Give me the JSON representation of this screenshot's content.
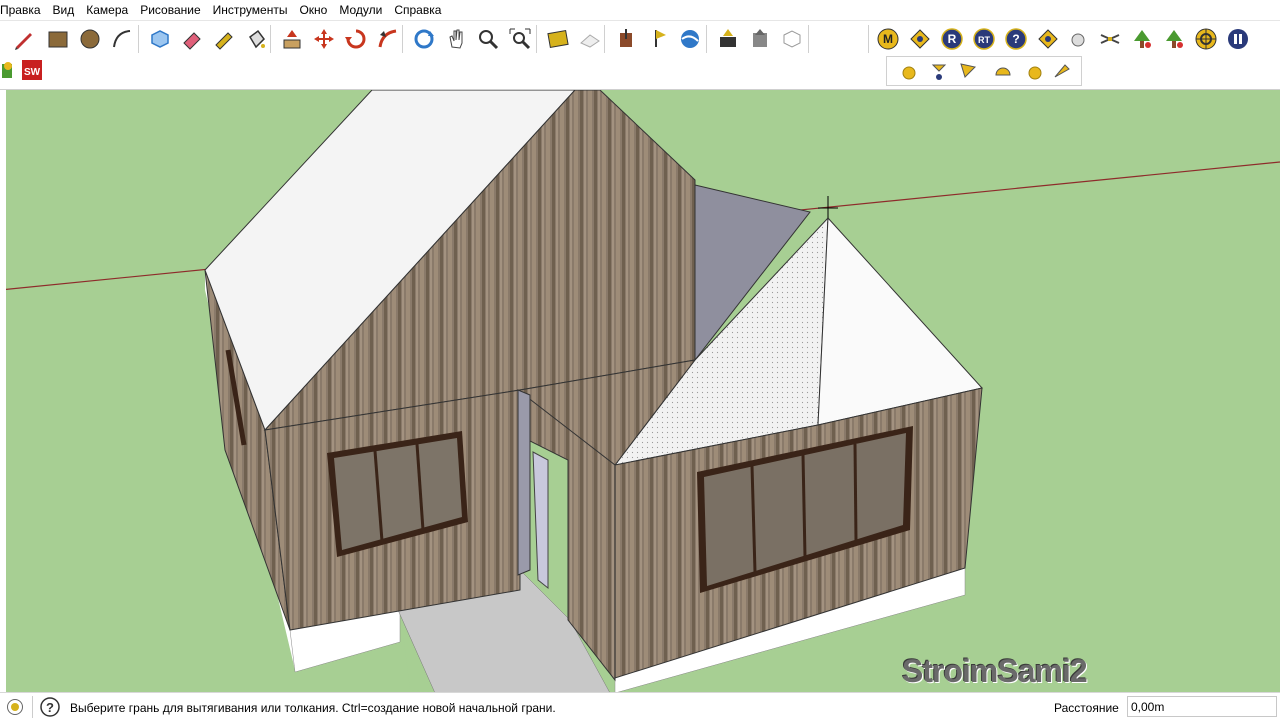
{
  "menu": [
    "Правка",
    "Вид",
    "Камера",
    "Рисование",
    "Инструменты",
    "Окно",
    "Модули",
    "Справка"
  ],
  "toolbar_main": [
    {
      "icon": "pencil-icon",
      "color": "#c03030"
    },
    {
      "icon": "rectangle-icon",
      "color": "#8b6a3a"
    },
    {
      "icon": "circle-icon",
      "color": "#8b6a3a"
    },
    {
      "icon": "arc-icon",
      "color": "#333333"
    },
    {
      "icon": "make-component-icon",
      "color": "#2f78c8"
    },
    {
      "icon": "eraser-icon",
      "color": "#e0607a"
    },
    {
      "icon": "tape-measure-icon",
      "color": "#d6b21c"
    },
    {
      "icon": "paint-bucket-icon",
      "color": "#333333"
    },
    {
      "icon": "push-pull-icon",
      "color": "#c8361e"
    },
    {
      "icon": "move-icon",
      "color": "#c8361e"
    },
    {
      "icon": "rotate-icon",
      "color": "#c8361e"
    },
    {
      "icon": "follow-me-icon",
      "color": "#c8361e"
    },
    {
      "icon": "orbit-icon",
      "color": "#2f78c8"
    },
    {
      "icon": "pan-icon",
      "color": "#444444"
    },
    {
      "icon": "zoom-icon",
      "color": "#333333"
    },
    {
      "icon": "zoom-extents-icon",
      "color": "#333333"
    },
    {
      "icon": "add-location-icon",
      "color": "#d6b21c"
    },
    {
      "icon": "toggle-terrain-icon",
      "color": "#aaaaaa"
    },
    {
      "icon": "get-models-icon",
      "color": "#8b4a2a"
    },
    {
      "icon": "share-model-icon",
      "color": "#d6b21c"
    },
    {
      "icon": "google-earth-icon",
      "color": "#2f78c8"
    },
    {
      "icon": "warehouse-icon",
      "color": "#d6b21c"
    },
    {
      "icon": "share-component-icon",
      "color": "#666666"
    },
    {
      "icon": "extension-warehouse-icon",
      "color": "#999999"
    }
  ],
  "toolbar_plugins": [
    {
      "icon": "plugin-m-icon",
      "glyph": "M"
    },
    {
      "icon": "plugin-tag-icon",
      "glyph": ""
    },
    {
      "icon": "plugin-r-icon",
      "glyph": "R"
    },
    {
      "icon": "plugin-rt-icon",
      "glyph": "RT"
    },
    {
      "icon": "help-icon",
      "glyph": "?"
    },
    {
      "icon": "plugin-label-icon",
      "glyph": ""
    },
    {
      "icon": "plugin-sphere-icon",
      "glyph": ""
    },
    {
      "icon": "plugin-cross-icon",
      "glyph": ""
    },
    {
      "icon": "plugin-tree-icon",
      "glyph": ""
    },
    {
      "icon": "plugin-plant-icon",
      "glyph": ""
    },
    {
      "icon": "plugin-target-icon",
      "glyph": ""
    },
    {
      "icon": "pause-icon",
      "glyph": ""
    }
  ],
  "toolbar_row2": [
    "plugin-sandbox-icon",
    "plugin-sw-icon"
  ],
  "toolbar_row2_right": [
    "sphere-icon",
    "light-icon",
    "spot-icon",
    "dome-icon",
    "sphere2-icon",
    "beam-icon"
  ],
  "status": {
    "message": "Выберите грань для вытягивания или толкания. Ctrl=создание новой начальной грани.",
    "distance_label": "Расстояние",
    "distance_value": "0,00m"
  },
  "watermark": "StroimSami2"
}
